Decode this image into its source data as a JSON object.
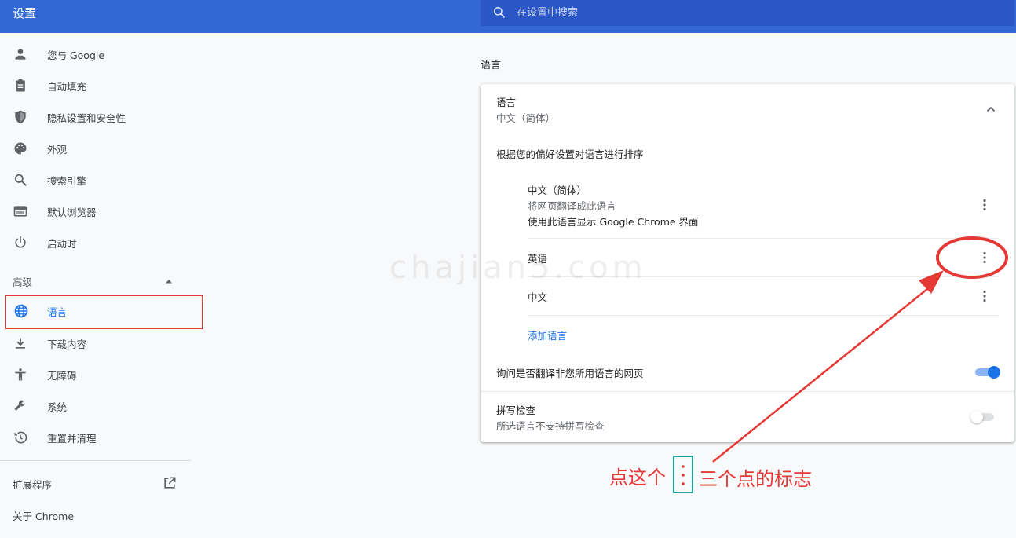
{
  "header": {
    "title": "设置",
    "search_placeholder": "在设置中搜索"
  },
  "sidebar": {
    "items": [
      {
        "label": "您与 Google",
        "icon": "person-icon"
      },
      {
        "label": "自动填充",
        "icon": "clipboard-icon"
      },
      {
        "label": "隐私设置和安全性",
        "icon": "shield-icon"
      },
      {
        "label": "外观",
        "icon": "palette-icon"
      },
      {
        "label": "搜索引擎",
        "icon": "search-icon"
      },
      {
        "label": "默认浏览器",
        "icon": "browser-icon"
      },
      {
        "label": "启动时",
        "icon": "power-icon"
      }
    ],
    "advanced_label": "高级",
    "advanced_items": [
      {
        "label": "语言",
        "icon": "globe-icon",
        "active": true
      },
      {
        "label": "下载内容",
        "icon": "download-icon"
      },
      {
        "label": "无障碍",
        "icon": "accessibility-icon"
      },
      {
        "label": "系统",
        "icon": "wrench-icon"
      },
      {
        "label": "重置并清理",
        "icon": "restore-icon"
      }
    ],
    "extensions_label": "扩展程序",
    "about_label": "关于 Chrome"
  },
  "main": {
    "section_title": "语言",
    "languages_card": {
      "title": "语言",
      "current_language": "中文（简体）",
      "order_hint": "根据您的偏好设置对语言进行排序",
      "languages": [
        {
          "name": "中文（简体）",
          "line2": "将网页翻译成此语言",
          "line3": "使用此语言显示 Google Chrome 界面"
        },
        {
          "name": "英语"
        },
        {
          "name": "中文"
        }
      ],
      "add_language": "添加语言",
      "translate_offer": "询问是否翻译非您所用语言的网页",
      "translate_enabled": true,
      "spellcheck_title": "拼写检查",
      "spellcheck_subtitle": "所选语言不支持拼写检查",
      "spellcheck_enabled": false
    }
  },
  "watermark": "chajian5.com",
  "annotation": {
    "caption_before": "点这个",
    "caption_after": "三个点的标志",
    "color": "#e53935",
    "box_color": "#1aa39a"
  }
}
